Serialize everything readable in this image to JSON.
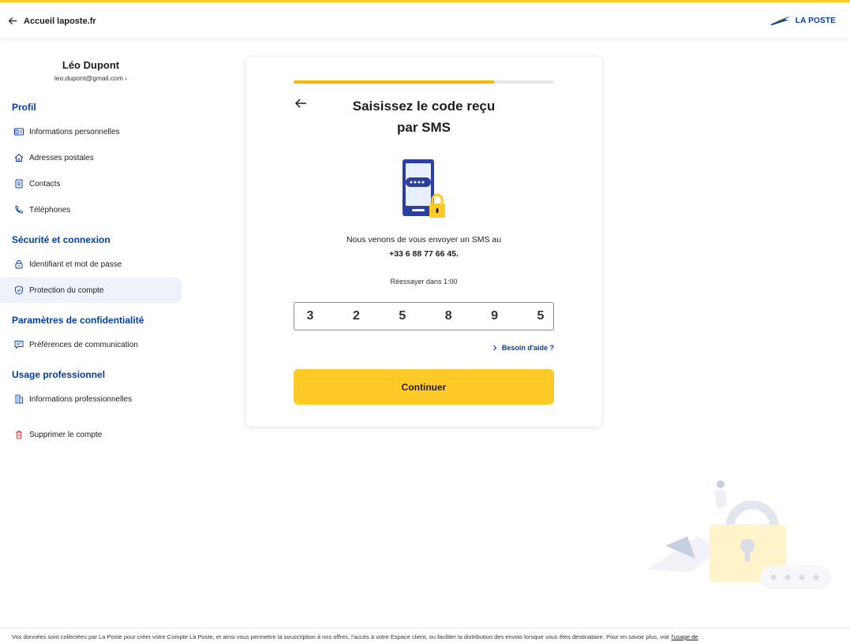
{
  "header": {
    "back_label": "Accueil laposte.fr",
    "logo_text": "LA POSTE"
  },
  "user": {
    "name": "Léo Dupont",
    "email": "leo.dupont@gmail.com  ›"
  },
  "sidebar": {
    "sections": [
      {
        "title": "Profil"
      },
      {
        "title": "Sécurité et connexion"
      },
      {
        "title": "Paramètres de confidentialité"
      },
      {
        "title": "Usage professionnel"
      }
    ],
    "items": [
      {
        "label": "Informations personnelles",
        "icon": "id-card-icon"
      },
      {
        "label": "Adresses postales",
        "icon": "home-icon"
      },
      {
        "label": "Contacts",
        "icon": "contacts-icon"
      },
      {
        "label": "Téléphones",
        "icon": "phone-icon"
      },
      {
        "label": "Identifiant et mot de passe",
        "icon": "lock-icon"
      },
      {
        "label": "Protection du compte",
        "icon": "shield-icon",
        "active": true
      },
      {
        "label": "Préférences de communication",
        "icon": "chat-icon"
      },
      {
        "label": "Informations professionnelles",
        "icon": "building-icon"
      },
      {
        "label": "Supprimer le compte",
        "icon": "trash-icon"
      }
    ]
  },
  "card": {
    "progress_percent": 77,
    "title_line1": "Saisissez le code reçu",
    "title_line2": "par SMS",
    "message_line1": "Nous venons de vous envoyer un SMS au",
    "phone_number": "+33 6 88 77 66 45.",
    "retry_text": "Réessayer dans 1:00",
    "code_digits": [
      "3",
      "2",
      "5",
      "8",
      "9",
      "5"
    ],
    "help_link": "Besoin d'aide ?",
    "continue_label": "Continuer"
  },
  "footer": {
    "text": "Vos données sont collectées par La Poste pour créer votre Compte La Poste, et ainsi vous permettre la souscription à nos offres, l'accès à votre Espace client, ou faciliter la distribution des envois lorsque vous êtes destinataire. Pour en savoir plus, voir ",
    "link": "l'usage de"
  },
  "colors": {
    "accent_yellow": "#ffc928",
    "brand_blue": "#003da5"
  }
}
